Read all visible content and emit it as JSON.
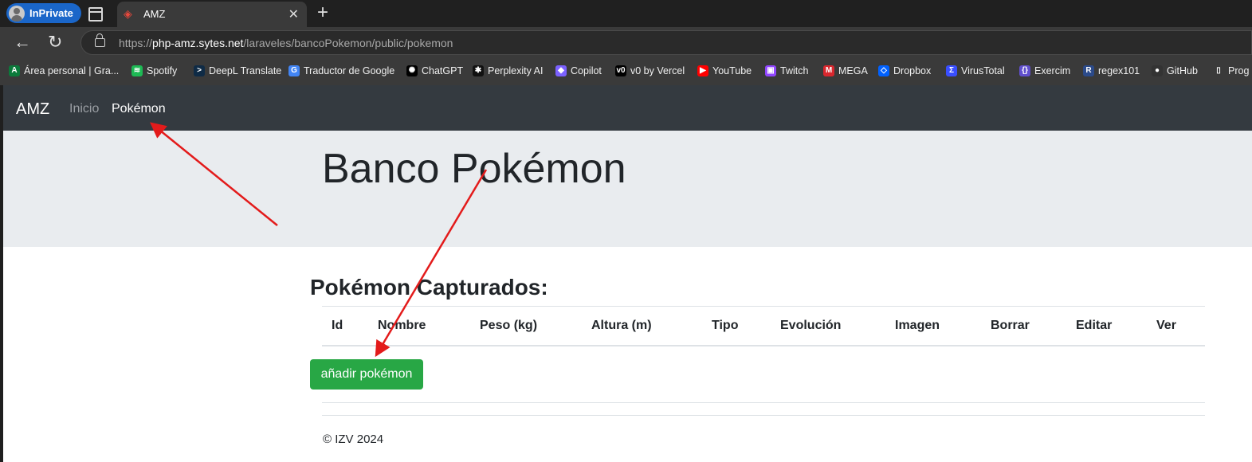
{
  "browser": {
    "inprivate_label": "InPrivate",
    "tab_title": "AMZ",
    "url_prefix": "https://",
    "url_host": "php-amz.sytes.net",
    "url_path": "/laraveles/bancoPokemon/public/pokemon"
  },
  "bookmarks": [
    {
      "label": "Área personal | Gra...",
      "icon": "area-personal-icon",
      "color": "#0b7a3b",
      "glyph": "A"
    },
    {
      "label": "Spotify",
      "icon": "spotify-icon",
      "color": "#1db954",
      "glyph": "≋"
    },
    {
      "label": "DeepL Translate",
      "icon": "deepl-icon",
      "color": "#0f2b46",
      "glyph": ">"
    },
    {
      "label": "Traductor de Google",
      "icon": "google-translate-icon",
      "color": "#4285f4",
      "glyph": "G"
    },
    {
      "label": "ChatGPT",
      "icon": "chatgpt-icon",
      "color": "#000000",
      "glyph": "✺"
    },
    {
      "label": "Perplexity AI",
      "icon": "perplexity-icon",
      "color": "#111111",
      "glyph": "✱"
    },
    {
      "label": "Copilot",
      "icon": "copilot-icon",
      "color": "#7b61ff",
      "glyph": "◆"
    },
    {
      "label": "v0 by Vercel",
      "icon": "v0-icon",
      "color": "#000000",
      "glyph": "v0"
    },
    {
      "label": "YouTube",
      "icon": "youtube-icon",
      "color": "#ff0000",
      "glyph": "▶"
    },
    {
      "label": "Twitch",
      "icon": "twitch-icon",
      "color": "#9146ff",
      "glyph": "▣"
    },
    {
      "label": "MEGA",
      "icon": "mega-icon",
      "color": "#d9272e",
      "glyph": "M"
    },
    {
      "label": "Dropbox",
      "icon": "dropbox-icon",
      "color": "#0061ff",
      "glyph": "◇"
    },
    {
      "label": "VirusTotal",
      "icon": "virustotal-icon",
      "color": "#394eff",
      "glyph": "Σ"
    },
    {
      "label": "Exercim",
      "icon": "exercism-icon",
      "color": "#604fcd",
      "glyph": "{}"
    },
    {
      "label": "regex101",
      "icon": "regex101-icon",
      "color": "#2b4a8a",
      "glyph": "R"
    },
    {
      "label": "GitHub",
      "icon": "github-icon",
      "color": "#333333",
      "glyph": "●"
    },
    {
      "label": "Prog",
      "icon": "page-icon",
      "color": "#3a3a3a",
      "glyph": "▯"
    }
  ],
  "navbar": {
    "brand": "AMZ",
    "links": [
      "Inicio",
      "Pokémon"
    ]
  },
  "jumbotron": {
    "title": "Banco Pokémon"
  },
  "section_title": "Pokémon Capturados:",
  "table": {
    "headers": [
      "Id",
      "Nombre",
      "Peso (kg)",
      "Altura (m)",
      "Tipo",
      "Evolución",
      "Imagen",
      "Borrar",
      "Editar",
      "Ver"
    ]
  },
  "add_button": "añadir pokémon",
  "footer": "© IZV 2024",
  "colors": {
    "navbar": "#343a40",
    "jumbotron": "#e9ecef",
    "button": "#28a745",
    "annotation_arrow": "#e31b1b"
  }
}
